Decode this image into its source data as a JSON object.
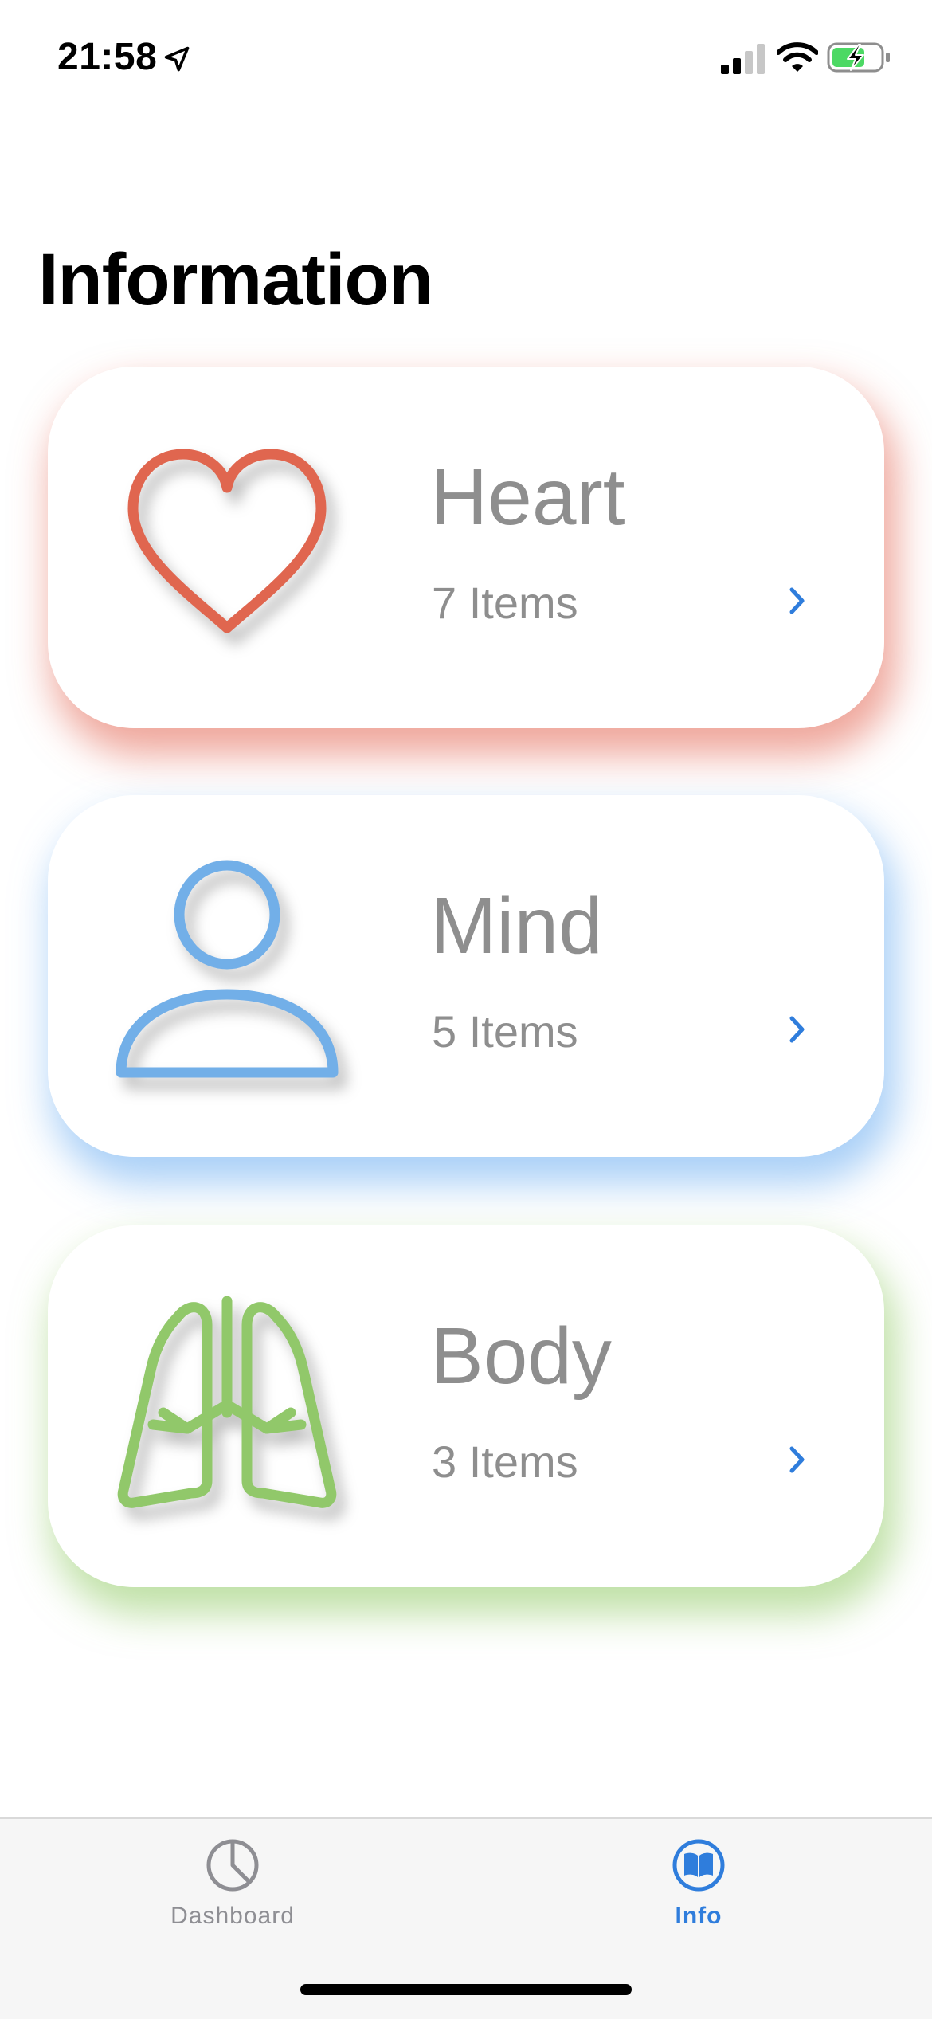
{
  "status_bar": {
    "time": "21:58",
    "icons": [
      "location-arrow-icon",
      "cellular-signal-icon",
      "wifi-icon",
      "battery-charging-icon"
    ]
  },
  "page": {
    "title": "Information"
  },
  "cards": [
    {
      "title": "Heart",
      "count": "7 Items",
      "icon": "heart-icon",
      "color": "#e0664f"
    },
    {
      "title": "Mind",
      "count": "5 Items",
      "icon": "person-icon",
      "color": "#72afe8"
    },
    {
      "title": "Body",
      "count": "3 Items",
      "icon": "lungs-icon",
      "color": "#91c86a"
    }
  ],
  "tab_bar": {
    "tabs": [
      {
        "label": "Dashboard",
        "icon": "pie-chart-icon",
        "selected": false
      },
      {
        "label": "Info",
        "icon": "book-icon",
        "selected": true
      }
    ]
  },
  "colors": {
    "accent": "#2f7ddc",
    "secondary_text": "#8e8e8e",
    "battery_green": "#4cd964"
  }
}
